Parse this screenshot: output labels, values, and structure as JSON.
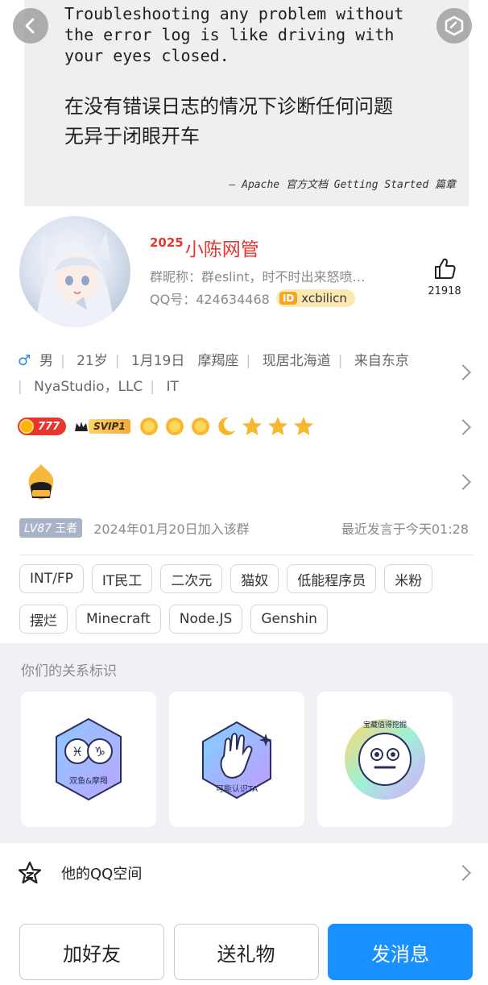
{
  "banner": {
    "text_en": "Troubleshooting any problem without\nthe error log is like driving with\nyour eyes closed.",
    "text_zh": "在没有错误日志的情况下诊断任何问题\n无异于闭眼开车",
    "source": "— Apache 官方文档 Getting Started 篇章"
  },
  "profile": {
    "name_prefix": "2025",
    "name": "小陈网管",
    "group_nickname": "群昵称：群eslint，时不时出来怒喷…",
    "qq_number": "QQ号：424634468",
    "id_tag": "ID",
    "id_value": "xcbilicn",
    "like_count": "21918"
  },
  "info": {
    "line1": [
      "男",
      "21岁",
      "1月19日",
      "摩羯座",
      "现居北海道",
      "来自东京"
    ],
    "line2": [
      "NyaStudio，LLC",
      "IT"
    ]
  },
  "badges": {
    "coin_value": "777",
    "svip_label": "SVIP1"
  },
  "group_meta": {
    "level": "LV87",
    "title": "王者",
    "joined": "2024年01月20日加入该群",
    "last_spoke": "最近发言于今天01:28"
  },
  "tags": [
    "INT/FP",
    "IT民工",
    "二次元",
    "猫奴",
    "低能程序员",
    "米粉",
    "摆烂",
    "Minecraft",
    "Node.JS",
    "Genshin"
  ],
  "relationship": {
    "title": "你们的关系标识",
    "cards": [
      {
        "label": "双鱼&摩羯"
      },
      {
        "label": "可能认识TA"
      },
      {
        "label": "宝藏值得挖掘"
      }
    ]
  },
  "qzone": {
    "label": "他的QQ空间"
  },
  "actions": {
    "add_friend": "加好友",
    "send_gift": "送礼物",
    "send_message": "发消息"
  },
  "colors": {
    "accent_blue": "#1890ff",
    "name_red": "#e8352e",
    "id_badge": "#fde7b3"
  }
}
